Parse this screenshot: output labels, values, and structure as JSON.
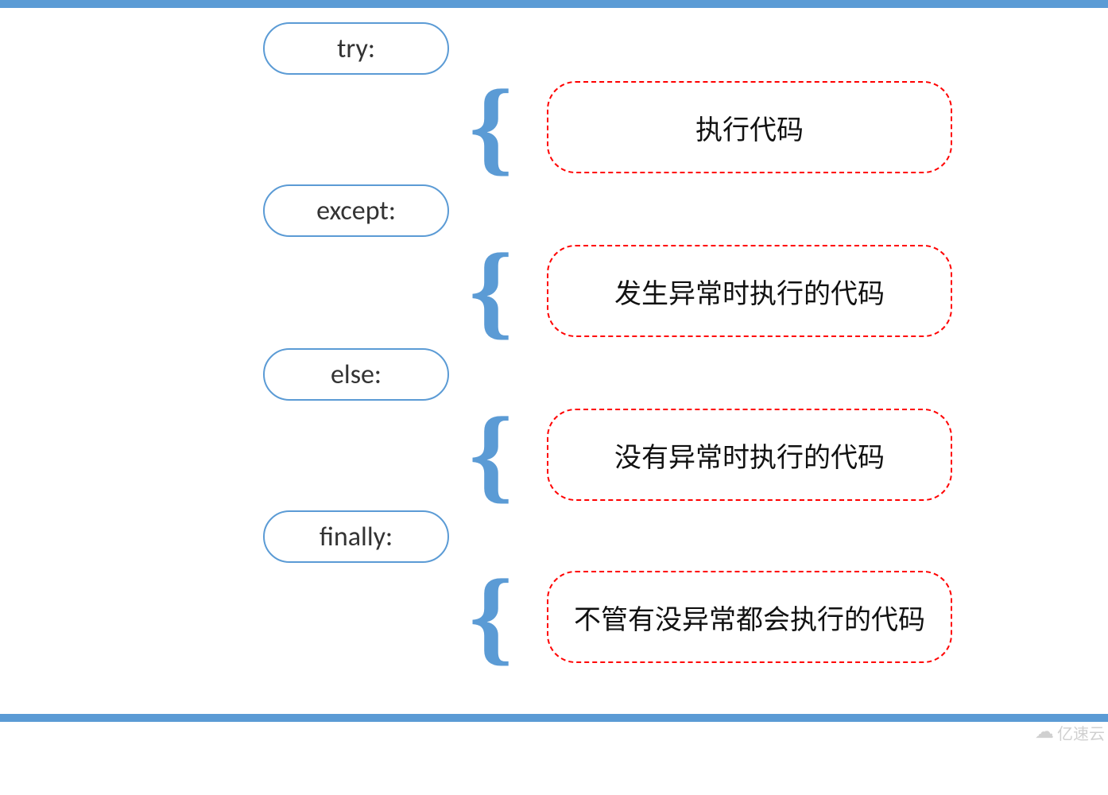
{
  "blocks": [
    {
      "keyword": "try:",
      "description": "执行代码"
    },
    {
      "keyword": "except:",
      "description": "发生异常时执行的代码"
    },
    {
      "keyword": "else:",
      "description": "没有异常时执行的代码"
    },
    {
      "keyword": "finally:",
      "description": "不管有没异常都会执行的代码"
    }
  ],
  "brace_glyph": "{",
  "watermark": "亿速云"
}
